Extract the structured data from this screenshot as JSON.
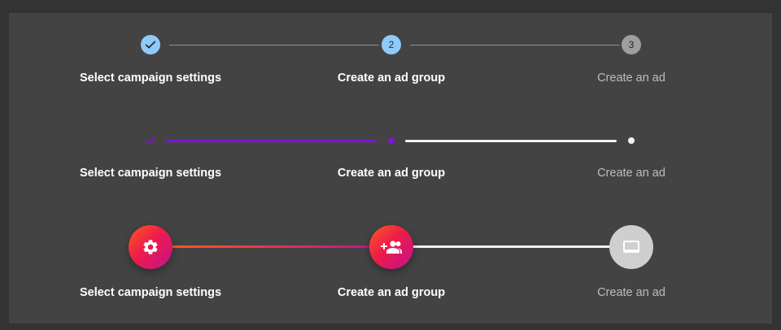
{
  "steppers": [
    {
      "variant": "numbered",
      "steps": [
        {
          "label": "Select campaign settings",
          "state": "completed",
          "icon": "check-icon"
        },
        {
          "label": "Create an ad group",
          "state": "active",
          "number": "2"
        },
        {
          "label": "Create an ad",
          "state": "inactive",
          "number": "3"
        }
      ]
    },
    {
      "variant": "dots",
      "steps": [
        {
          "label": "Select campaign settings",
          "state": "completed",
          "icon": "check-icon"
        },
        {
          "label": "Create an ad group",
          "state": "active"
        },
        {
          "label": "Create an ad",
          "state": "inactive"
        }
      ]
    },
    {
      "variant": "icons",
      "steps": [
        {
          "label": "Select campaign settings",
          "state": "completed",
          "icon": "gear-icon"
        },
        {
          "label": "Create an ad group",
          "state": "active",
          "icon": "add-group-icon"
        },
        {
          "label": "Create an ad",
          "state": "inactive",
          "icon": "video-label-icon"
        }
      ]
    }
  ],
  "colors": {
    "background": "#333333",
    "panel": "#434343",
    "step_blue": "#90caf9",
    "purple": "#7b16d6",
    "gradient_start": "#ff5a1e",
    "gradient_end": "#c2128a"
  }
}
